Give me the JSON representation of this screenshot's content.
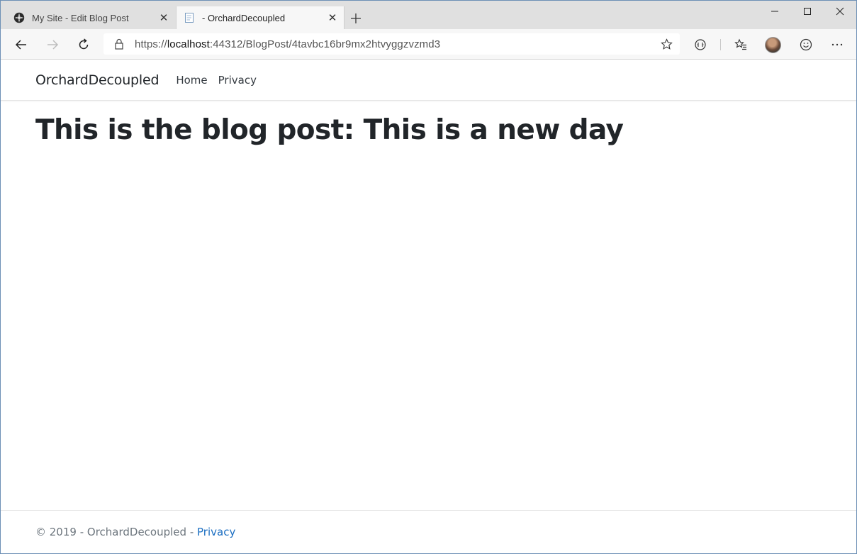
{
  "browser": {
    "tabs": [
      {
        "title": "My Site - Edit Blog Post",
        "icon": "orchard-icon",
        "active": false
      },
      {
        "title": "- OrchardDecoupled",
        "icon": "page-icon",
        "active": true
      }
    ],
    "address": {
      "scheme": "https://",
      "host": "localhost",
      "rest": ":44312/BlogPost/4tavbc16br9mx2htvyggzvzmd3"
    },
    "icons": {
      "back": "back-arrow-icon",
      "forward": "forward-arrow-icon",
      "refresh": "refresh-icon",
      "favorite": "star-icon",
      "reading": "reading-view-icon",
      "favorites_bar": "favorites-icon",
      "feedback": "smiley-icon",
      "more": "more-icon"
    }
  },
  "site": {
    "brand": "OrchardDecoupled",
    "nav": [
      "Home",
      "Privacy"
    ],
    "headline": "This is the blog post: This is a new day",
    "footer": {
      "prefix": "© 2019 - OrchardDecoupled - ",
      "link": "Privacy"
    }
  },
  "colors": {
    "link": "#1b6ec2",
    "text": "#212529",
    "muted": "#6c757d"
  }
}
